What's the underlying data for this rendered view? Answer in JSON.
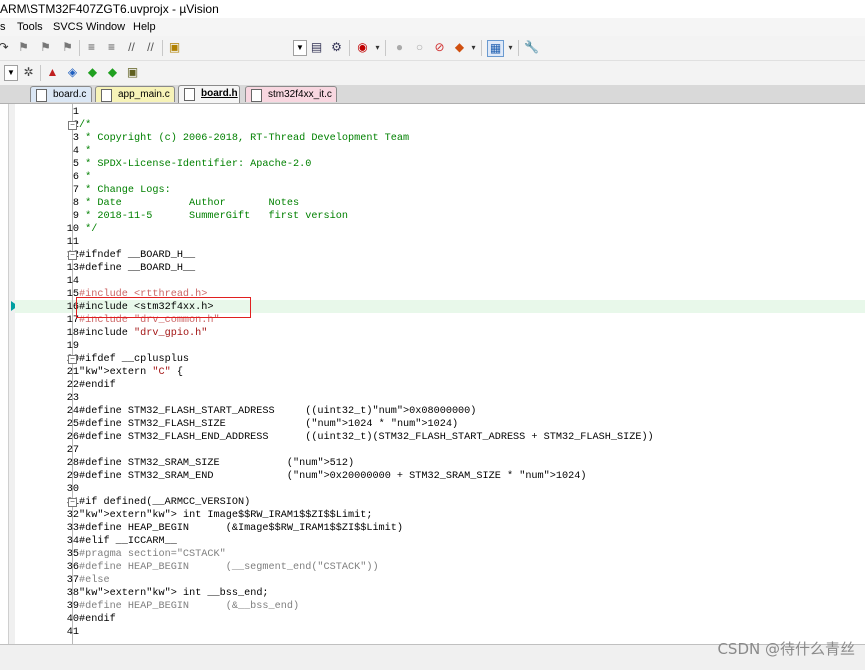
{
  "window": {
    "title": "ARM\\STM32F407ZGT6.uvprojx - µVision"
  },
  "menu": [
    "Tools",
    "SVCS",
    "Window",
    "Help"
  ],
  "menu_left_fragment": "s",
  "tabs": [
    {
      "label": "board.c",
      "color": "#dbe7f5"
    },
    {
      "label": "app_main.c",
      "color": "#f7f3b8"
    },
    {
      "label": "board.h",
      "color": "#f5f5f5",
      "active": true
    },
    {
      "label": "stm32f4xx_it.c",
      "color": "#f8d7e0"
    }
  ],
  "highlighted_line": 16,
  "code_lines": [
    {
      "n": "1",
      "t": ""
    },
    {
      "n": "2",
      "t": "/*",
      "c": "cmt",
      "fold": "-"
    },
    {
      "n": "3",
      "t": " * Copyright (c) 2006-2018, RT-Thread Development Team",
      "c": "cmt"
    },
    {
      "n": "4",
      "t": " *",
      "c": "cmt"
    },
    {
      "n": "5",
      "t": " * SPDX-License-Identifier: Apache-2.0",
      "c": "cmt"
    },
    {
      "n": "6",
      "t": " *",
      "c": "cmt"
    },
    {
      "n": "7",
      "t": " * Change Logs:",
      "c": "cmt"
    },
    {
      "n": "8",
      "t": " * Date           Author       Notes",
      "c": "cmt"
    },
    {
      "n": "9",
      "t": " * 2018-11-5      SummerGift   first version",
      "c": "cmt"
    },
    {
      "n": "10",
      "t": " */",
      "c": "cmt"
    },
    {
      "n": "11",
      "t": ""
    },
    {
      "n": "12",
      "t": "#ifndef __BOARD_H__",
      "c": "pp",
      "fold": "-"
    },
    {
      "n": "13",
      "t": "#define __BOARD_H__",
      "c": "pp"
    },
    {
      "n": "14",
      "t": ""
    },
    {
      "n": "15",
      "t": "#include <rtthread.h>",
      "c": "dstr"
    },
    {
      "n": "16",
      "t": "#include <stm32f4xx.h>",
      "c": "pp"
    },
    {
      "n": "17",
      "t": "#include \"drv_common.h\"",
      "c": "dstr"
    },
    {
      "n": "18",
      "t": "#include \"drv_gpio.h\"",
      "c": "mixstr"
    },
    {
      "n": "19",
      "t": ""
    },
    {
      "n": "20",
      "t": "#ifdef __cplusplus",
      "c": "pp",
      "fold": "-"
    },
    {
      "n": "21",
      "t": "extern \"C\" {",
      "c": "extc"
    },
    {
      "n": "22",
      "t": "#endif",
      "c": "pp"
    },
    {
      "n": "23",
      "t": ""
    },
    {
      "n": "24",
      "t": "#define STM32_FLASH_START_ADRESS     ((uint32_t)0x08000000)",
      "c": "pp"
    },
    {
      "n": "25",
      "t": "#define STM32_FLASH_SIZE             (1024 * 1024)",
      "c": "pp"
    },
    {
      "n": "26",
      "t": "#define STM32_FLASH_END_ADDRESS      ((uint32_t)(STM32_FLASH_START_ADRESS + STM32_FLASH_SIZE))",
      "c": "pp"
    },
    {
      "n": "27",
      "t": ""
    },
    {
      "n": "28",
      "t": "#define STM32_SRAM_SIZE           (512)",
      "c": "pp"
    },
    {
      "n": "29",
      "t": "#define STM32_SRAM_END            (0x20000000 + STM32_SRAM_SIZE * 1024)",
      "c": "pp"
    },
    {
      "n": "30",
      "t": ""
    },
    {
      "n": "31",
      "t": "#if defined(__ARMCC_VERSION)",
      "c": "pp",
      "fold": "-"
    },
    {
      "n": "32",
      "t": "extern int Image$$RW_IRAM1$$ZI$$Limit;",
      "c": "ext"
    },
    {
      "n": "33",
      "t": "#define HEAP_BEGIN      (&Image$$RW_IRAM1$$ZI$$Limit)",
      "c": "pp"
    },
    {
      "n": "34",
      "t": "#elif __ICCARM__",
      "c": "pp"
    },
    {
      "n": "35",
      "t": "#pragma section=\"CSTACK\"",
      "c": "dim"
    },
    {
      "n": "36",
      "t": "#define HEAP_BEGIN      (__segment_end(\"CSTACK\"))",
      "c": "dim"
    },
    {
      "n": "37",
      "t": "#else",
      "c": "dim"
    },
    {
      "n": "38",
      "t": "extern int __bss_end;",
      "c": "ext"
    },
    {
      "n": "39",
      "t": "#define HEAP_BEGIN      (&__bss_end)",
      "c": "dim"
    },
    {
      "n": "40",
      "t": "#endif",
      "c": "pp"
    },
    {
      "n": "41",
      "t": ""
    }
  ],
  "watermark": "CSDN @待什么青丝"
}
